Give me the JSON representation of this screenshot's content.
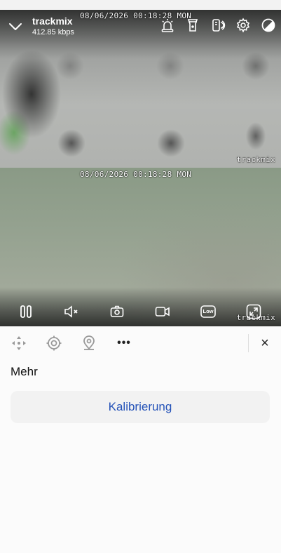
{
  "video": {
    "osd_timestamp_top": "08/06/2026 00:18:28 MON",
    "osd_brand_top": "trackmix",
    "osd_timestamp_bottom": "08/06/2026 00:18:28 MON",
    "osd_brand_bottom": "trackmix"
  },
  "header": {
    "camera_name": "trackmix",
    "bitrate": "412.85 kbps",
    "icons": [
      "chevron-down-icon",
      "siren-icon",
      "spotlight-icon",
      "device-icon",
      "gear-icon",
      "contrast-icon"
    ]
  },
  "controls": {
    "quality_label": "Low",
    "icons": [
      "pause-icon",
      "mute-icon",
      "snapshot-icon",
      "record-icon",
      "quality-icon",
      "fullscreen-icon"
    ]
  },
  "ptz": {
    "icons": [
      "ptz-arrows-icon",
      "target-icon",
      "preset-location-icon",
      "more-icon",
      "close-icon"
    ],
    "more_label": "•••",
    "close_label": "×"
  },
  "panel": {
    "section_title": "Mehr",
    "calibration_button": "Kalibrierung"
  },
  "colors": {
    "accent": "#2553b8",
    "panel_background": "#fbfbfb",
    "button_background": "#f2f2f2"
  }
}
